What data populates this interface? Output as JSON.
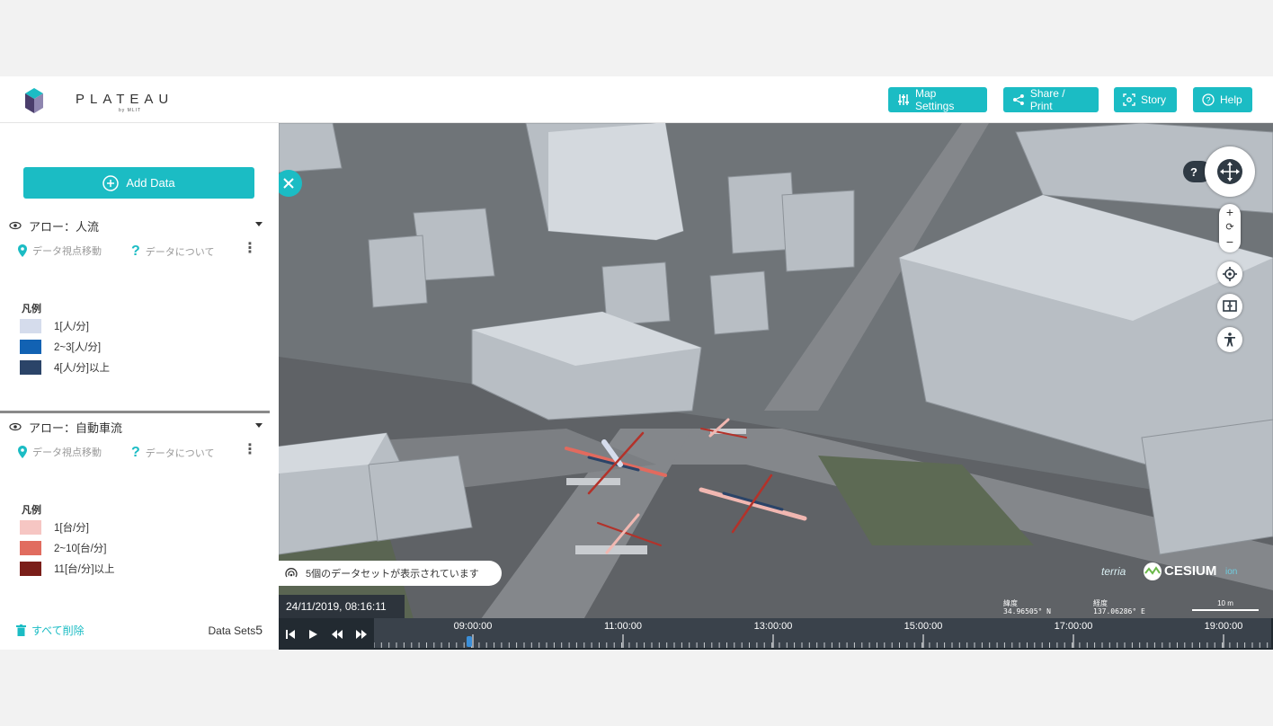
{
  "header": {
    "logo_text": "PLATEAU",
    "logo_sub": "by MLIT",
    "buttons": {
      "map_settings": "Map Settings",
      "share_print": "Share / Print",
      "story": "Story",
      "help": "Help"
    }
  },
  "sidebar": {
    "add_data_label": "Add Data",
    "layers": [
      {
        "title": "アロー：人流",
        "action_move": "データ視点移動",
        "action_about": "データについて",
        "legend_title": "凡例",
        "legend": [
          {
            "label": "1[人/分]",
            "color": "#d5dcec"
          },
          {
            "label": "2~3[人/分]",
            "color": "#1262b3"
          },
          {
            "label": "4[人/分]以上",
            "color": "#2b4468"
          }
        ]
      },
      {
        "title": "アロー：自動車流",
        "action_move": "データ視点移動",
        "action_about": "データについて",
        "legend_title": "凡例",
        "legend": [
          {
            "label": "1[台/分]",
            "color": "#f6c6c3"
          },
          {
            "label": "2~10[台/分]",
            "color": "#e16c5f"
          },
          {
            "label": "11[台/分]以上",
            "color": "#7a1e19"
          }
        ]
      }
    ],
    "clear_all_label": "すべて削除",
    "dataset_label": "Data Sets",
    "dataset_count": "5"
  },
  "map": {
    "dataset_message": "5個のデータセットが表示されています",
    "current_time": "24/11/2019, 08:16:11",
    "credits": {
      "terria": "terria",
      "cesium": "CESIUM",
      "ion": "ion"
    },
    "lat_label": "緯度",
    "lat_value": "34.96505° N",
    "lon_label": "経度",
    "lon_value": "137.06286° E",
    "scale_label": "10 m",
    "help_symbol": "?"
  },
  "timeline": {
    "ticks": [
      "09:00:00",
      "11:00:00",
      "13:00:00",
      "15:00:00",
      "17:00:00",
      "19:00:00"
    ]
  },
  "colors": {
    "accent": "#1bbcc4",
    "dark": "#222a31"
  }
}
